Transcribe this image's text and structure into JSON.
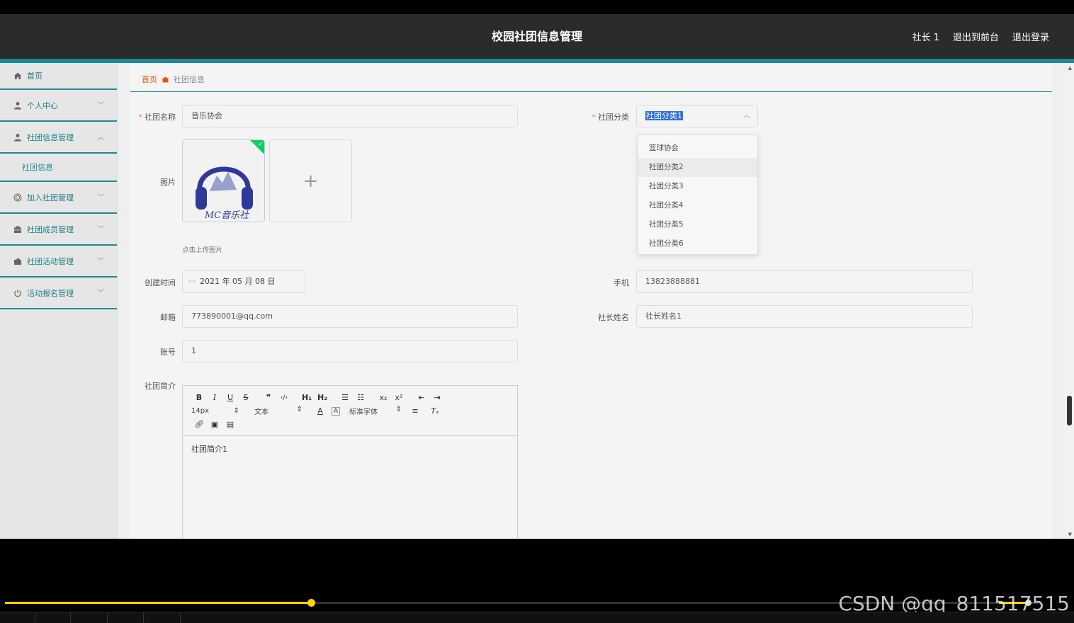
{
  "header": {
    "title": "校园社团信息管理",
    "user": "社长 1",
    "back_front": "退出到前台",
    "logout": "退出登录"
  },
  "sidebar": {
    "items": [
      {
        "label": "首页",
        "icon": "home-icon"
      },
      {
        "label": "个人中心",
        "icon": "user-icon"
      },
      {
        "label": "社团信息管理",
        "icon": "user-icon"
      },
      {
        "label": "社团信息",
        "icon": ""
      },
      {
        "label": "加入社团管理",
        "icon": "target-icon"
      },
      {
        "label": "社团成员管理",
        "icon": "briefcase-icon"
      },
      {
        "label": "社团活动管理",
        "icon": "wallet-icon"
      },
      {
        "label": "活动报名管理",
        "icon": "power-icon"
      }
    ]
  },
  "breadcrumb": {
    "home": "首页",
    "current": "社团信息"
  },
  "form": {
    "name_label": "社团名称",
    "name_value": "音乐协会",
    "category_label": "社团分类",
    "category_value": "社团分类1",
    "category_options": [
      "篮球协会",
      "社团分类2",
      "社团分类3",
      "社团分类4",
      "社团分类5",
      "社团分类6"
    ],
    "image_label": "图片",
    "image_caption": "MC音乐社",
    "upload_tip": "点击上传图片",
    "created_label": "创建时间",
    "created_value": "2021 年 05 月 08 日",
    "phone_label": "手机",
    "phone_value": "13823888881",
    "email_label": "邮箱",
    "email_value": "773890001@qq.com",
    "leader_label": "社长姓名",
    "leader_value": "社长姓名1",
    "account_label": "账号",
    "account_value": "1",
    "intro_label": "社团简介",
    "intro_value": "社团简介1"
  },
  "editor": {
    "font_size": "14px",
    "text_type": "文本",
    "font_family": "标准字体"
  },
  "watermark": "CSDN @qq_811517515",
  "colors": {
    "accent": "#1c8a94",
    "header_bg": "#2b2b2b",
    "breadcrumb_home": "#e8560a",
    "progress": "#ffd400"
  },
  "player": {
    "progress": 0.297
  }
}
